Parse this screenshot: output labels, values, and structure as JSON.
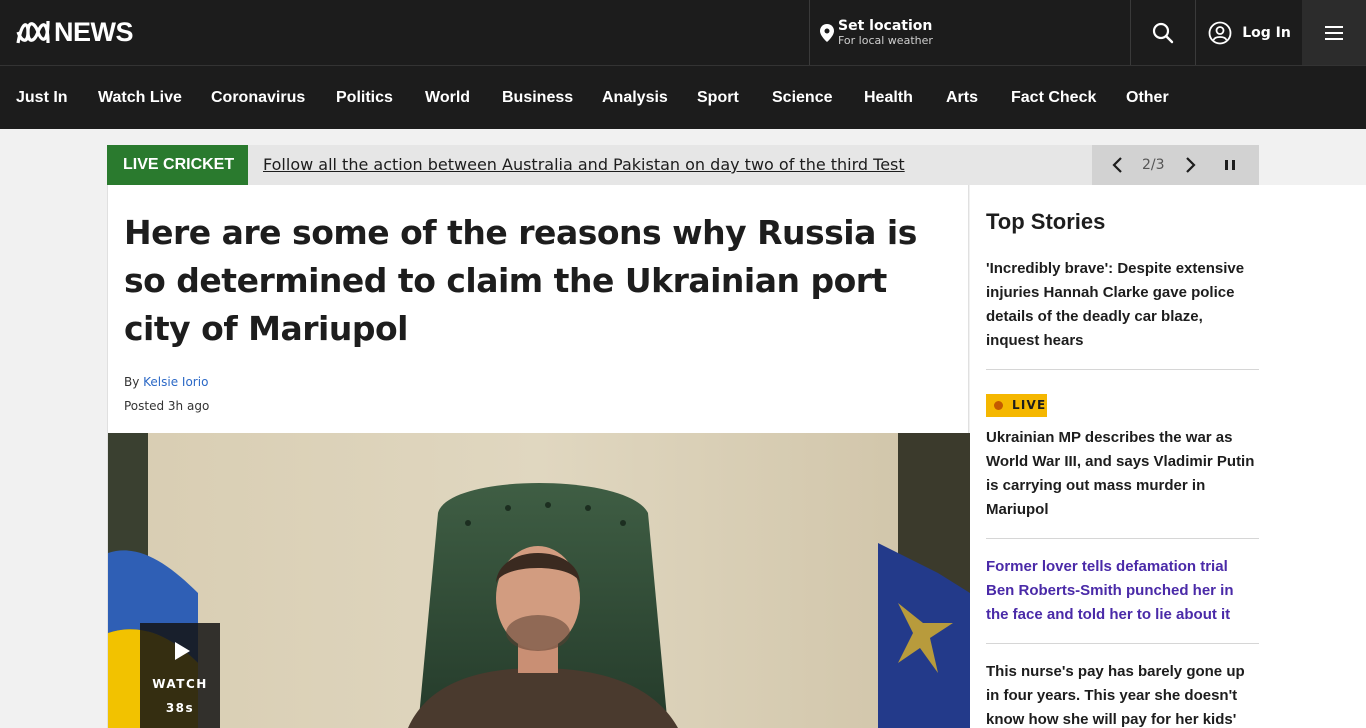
{
  "header": {
    "logo_text": "NEWS",
    "location_title": "Set location",
    "location_subtitle": "For local weather",
    "login_label": "Log In"
  },
  "nav": {
    "items": [
      {
        "label": "Just In"
      },
      {
        "label": "Watch Live"
      },
      {
        "label": "Coronavirus"
      },
      {
        "label": "Politics"
      },
      {
        "label": "World"
      },
      {
        "label": "Business"
      },
      {
        "label": "Analysis"
      },
      {
        "label": "Sport"
      },
      {
        "label": "Science"
      },
      {
        "label": "Health"
      },
      {
        "label": "Arts"
      },
      {
        "label": "Fact Check"
      },
      {
        "label": "Other"
      }
    ]
  },
  "ticker": {
    "label": "LIVE CRICKET",
    "text": "Follow all the action between Australia and Pakistan on day two of the third Test",
    "counter": "2/3"
  },
  "article": {
    "headline": "Here are some of the reasons why Russia is so determined to claim the Ukrainian port city of Mariupol",
    "by_prefix": "By ",
    "author": "Kelsie Iorio",
    "posted": "Posted 3h ago",
    "watch_label": "WATCH",
    "watch_duration": "38s"
  },
  "top_stories": {
    "title": "Top Stories",
    "live_badge": "LIVE",
    "stories": [
      {
        "headline": "'Incredibly brave': Despite extensive injuries Hannah Clarke gave police details of the deadly car blaze, inquest hears"
      },
      {
        "headline": "Ukrainian MP describes the war as World War III, and says Vladimir Putin is carrying out mass murder in Mariupol"
      },
      {
        "headline": "Former lover tells defamation trial Ben Roberts-Smith punched her in the face and told her to lie about it"
      },
      {
        "headline": "This nurse's pay has barely gone up in four years. This year she doesn't know how she will pay for her kids'"
      }
    ]
  },
  "colors": {
    "header_bg": "#1c1c1c",
    "ticker_label_bg": "#2a7a2e",
    "live_badge_bg": "#f5b700",
    "visited_link": "#4a2aa8",
    "author_link": "#2b68c6"
  },
  "icons": [
    "abc-logo-icon",
    "location-pin-icon",
    "search-icon",
    "user-icon",
    "menu-icon",
    "chevron-left-icon",
    "chevron-right-icon",
    "pause-icon",
    "play-icon"
  ]
}
